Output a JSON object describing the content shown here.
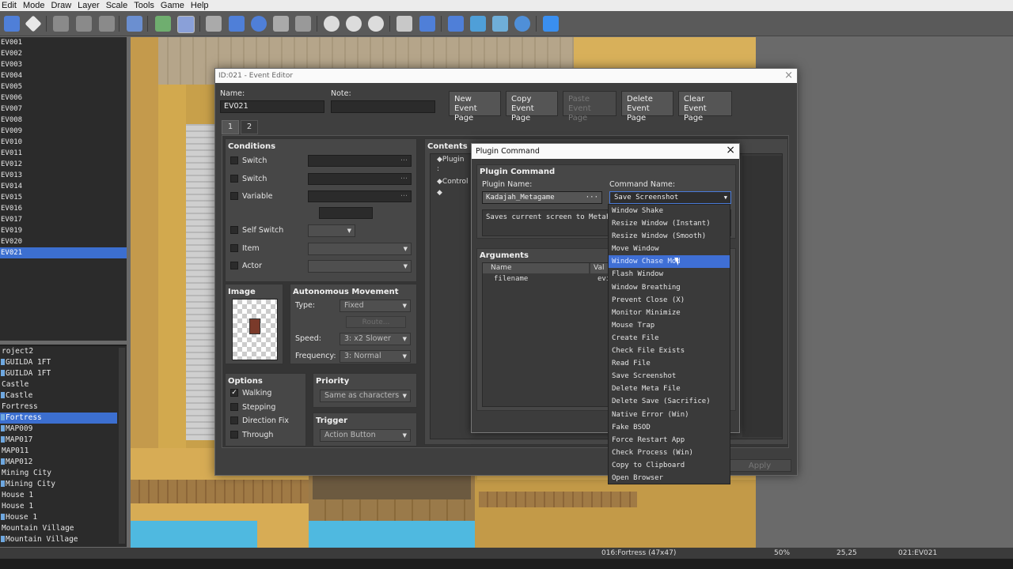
{
  "menu": [
    "Edit",
    "Mode",
    "Draw",
    "Layer",
    "Scale",
    "Tools",
    "Game",
    "Help"
  ],
  "events": [
    "EV001",
    "EV002",
    "EV003",
    "EV004",
    "EV005",
    "EV006",
    "EV007",
    "EV008",
    "EV009",
    "EV010",
    "EV011",
    "EV012",
    "EV013",
    "EV014",
    "EV015",
    "EV016",
    "EV017",
    "EV019",
    "EV020",
    "EV021"
  ],
  "maps": [
    "roject2",
    "GUILDA 1FT",
    "GUILDA 1FT",
    "Castle",
    "Castle",
    "Fortress",
    "Fortress",
    "MAP009",
    "MAP017",
    "MAP011",
    "MAP012",
    "Mining City",
    "Mining City",
    "House 1",
    "House 1",
    "House 1",
    "Mountain Village",
    "Mountain Village"
  ],
  "status": {
    "map": "016:Fortress (47x47)",
    "zoom": "50%",
    "coords": "25,25",
    "event": "021:EV021"
  },
  "editor": {
    "title": "ID:021 - Event Editor",
    "name_label": "Name:",
    "name_value": "EV021",
    "note_label": "Note:",
    "btn_new": [
      "New",
      "Event Page"
    ],
    "btn_copy": [
      "Copy",
      "Event Page"
    ],
    "btn_paste": [
      "Paste",
      "Event Page"
    ],
    "btn_delete": [
      "Delete",
      "Event Page"
    ],
    "btn_clear": [
      "Clear",
      "Event Page"
    ],
    "tabs": [
      "1",
      "2"
    ],
    "conditions_title": "Conditions",
    "cond_switch1": "Switch",
    "cond_switch2": "Switch",
    "cond_variable": "Variable",
    "cond_self_switch": "Self Switch",
    "cond_item": "Item",
    "cond_actor": "Actor",
    "image_title": "Image",
    "auto_title": "Autonomous Movement",
    "type_label": "Type:",
    "type_value": "Fixed",
    "route": "Route...",
    "speed_label": "Speed:",
    "speed_value": "3: x2 Slower",
    "freq_label": "Frequency:",
    "freq_value": "3: Normal",
    "options_title": "Options",
    "opt_walking": "Walking",
    "opt_stepping": "Stepping",
    "opt_dirfix": "Direction Fix",
    "opt_through": "Through",
    "priority_title": "Priority",
    "priority_value": "Same as characters",
    "trigger_title": "Trigger",
    "trigger_value": "Action Button",
    "contents_title": "Contents",
    "content_lines": [
      "◆Plugin",
      "  :",
      "◆Control",
      "◆"
    ],
    "apply": "Apply"
  },
  "plugin": {
    "title": "Plugin Command",
    "section": "Plugin Command",
    "plugin_name_label": "Plugin Name:",
    "plugin_name_value": "Kadajah_Metagame",
    "command_name_label": "Command Name:",
    "command_name_value": "Save Screenshot",
    "description": "Saves current screen to MetaFile",
    "arguments_title": "Arguments",
    "col_name": "Name",
    "col_value": "Val",
    "arg_name": "filename",
    "arg_value": "evi"
  },
  "dropdown_items": [
    "Window Shake",
    "Resize Window (Instant)",
    "Resize Window (Smooth)",
    "Move Window",
    "Window Chase Mod",
    "Flash Window",
    "Window Breathing",
    "Prevent Close (X)",
    "Monitor Minimize",
    "Mouse Trap",
    "Create File",
    "Check File Exists",
    "Read File",
    "Save Screenshot",
    "Delete Meta File",
    "Delete Save (Sacrifice)",
    "Native Error (Win)",
    "Fake BSOD",
    "Force Restart App",
    "Check Process (Win)",
    "Copy to Clipboard",
    "Open Browser"
  ],
  "dropdown_highlight_index": 4,
  "colors": {
    "selection": "#3c6fd0",
    "panel": "#474747",
    "dialog": "#3f3f3f"
  }
}
